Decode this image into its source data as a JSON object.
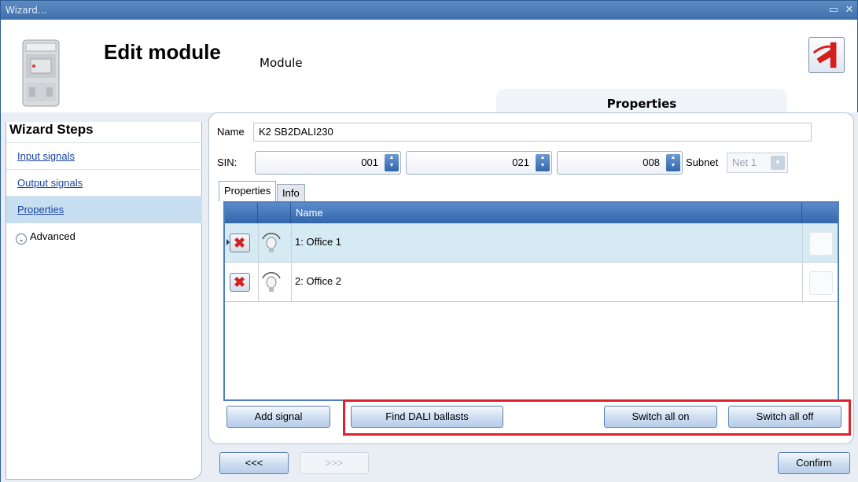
{
  "window": {
    "title": "Wizard...",
    "controls": [
      "▭",
      "✕"
    ]
  },
  "header": {
    "title": "Edit module",
    "subtitle": "Module",
    "tab_label": "Properties"
  },
  "wizard": {
    "title": "Wizard Steps",
    "steps": [
      {
        "label": "Input signals"
      },
      {
        "label": "Output signals"
      },
      {
        "label": "Properties"
      },
      {
        "label": "Advanced"
      }
    ]
  },
  "form": {
    "name_label": "Name",
    "name_value": "K2 SB2DALI230",
    "sin_label": "SIN:",
    "sin_values": [
      "001",
      "021",
      "008"
    ],
    "subnet_label": "Subnet",
    "subnet_value": "Net 1"
  },
  "tabs": [
    {
      "label": "Properties",
      "active": true
    },
    {
      "label": "Info",
      "active": false
    }
  ],
  "grid": {
    "column_name": "Name",
    "rows": [
      {
        "name": "1: Office 1",
        "selected": true
      },
      {
        "name": "2: Office 2",
        "selected": false
      }
    ]
  },
  "actions": {
    "add_signal": "Add signal",
    "find_dali": "Find DALI ballasts",
    "switch_all_on": "Switch all on",
    "switch_all_off": "Switch all off"
  },
  "footer": {
    "back": "<<<",
    "next": ">>>",
    "confirm": "Confirm"
  },
  "colors": {
    "title_bar": "#4a7ab8",
    "grid_header": "#3f72b4",
    "highlight": "#e0202a",
    "selected_row": "#d6eaf3"
  }
}
